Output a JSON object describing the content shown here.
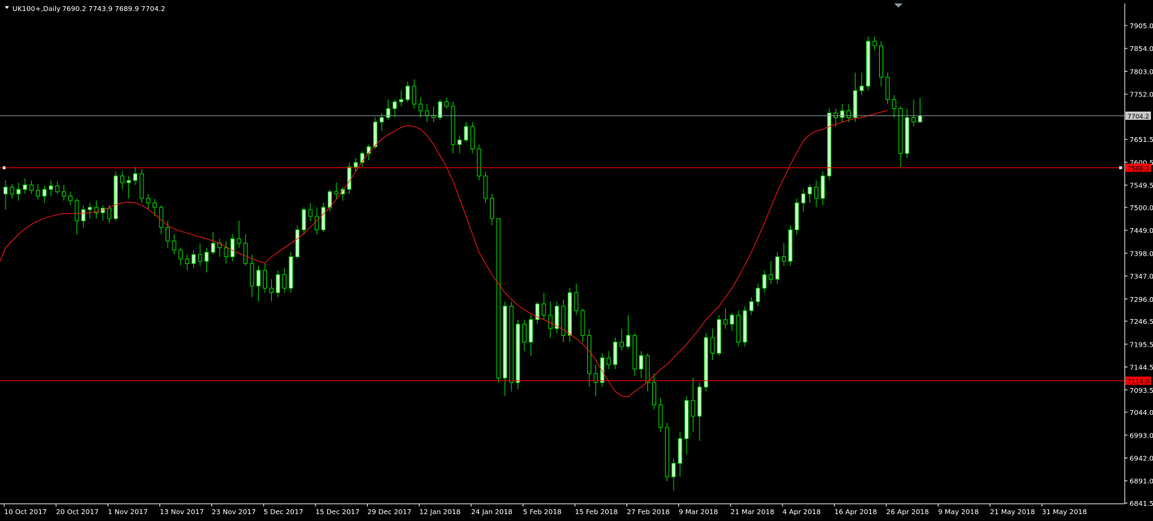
{
  "header": {
    "symbol": "UK100+,Daily",
    "ohlc": "7690.2 7743.9 7689.9 7704.2"
  },
  "colors": {
    "background": "#000000",
    "bull_body": "#ccffcc",
    "bear_body": "#000000",
    "wick": "#00dd00",
    "ma": "#ff1a1a",
    "hline": "#ff0000",
    "bid": "#8c9aa5",
    "axis": "#ffffff"
  },
  "price_axis": {
    "labels": [
      "7905.0",
      "7854.0",
      "7803.0",
      "7752.0",
      "7651.5",
      "7600.5",
      "7549.5",
      "7500.0",
      "7449.0",
      "7398.0",
      "7347.0",
      "7296.0",
      "7246.5",
      "7195.5",
      "7144.5",
      "7093.5",
      "7044.0",
      "6993.0",
      "6942.0",
      "6891.0",
      "6841.5"
    ],
    "current_price_tag": "7704.2",
    "resistance_tag": "7588.3",
    "support_tag": "7114.0"
  },
  "time_axis": {
    "labels": [
      "10 Oct 2017",
      "20 Oct 2017",
      "1 Nov 2017",
      "13 Nov 2017",
      "23 Nov 2017",
      "5 Dec 2017",
      "15 Dec 2017",
      "29 Dec 2017",
      "12 Jan 2018",
      "24 Jan 2018",
      "5 Feb 2018",
      "15 Feb 2018",
      "27 Feb 2018",
      "9 Mar 2018",
      "21 Mar 2018",
      "4 Apr 2018",
      "16 Apr 2018",
      "26 Apr 2018",
      "9 May 2018",
      "21 May 2018",
      "31 May 2018"
    ]
  },
  "chart_data": {
    "type": "candlestick",
    "timeframe": "Daily",
    "symbol": "UK100+",
    "ylim": [
      6841.5,
      7905.0
    ],
    "horizontal_lines": [
      7588.3,
      7114.0
    ],
    "current_price": 7704.2,
    "candles": [
      [
        7530,
        7560,
        7495,
        7545
      ],
      [
        7545,
        7552,
        7520,
        7530
      ],
      [
        7530,
        7555,
        7515,
        7540
      ],
      [
        7540,
        7565,
        7530,
        7550
      ],
      [
        7550,
        7560,
        7530,
        7538
      ],
      [
        7538,
        7552,
        7518,
        7525
      ],
      [
        7525,
        7548,
        7510,
        7540
      ],
      [
        7540,
        7560,
        7525,
        7548
      ],
      [
        7548,
        7558,
        7530,
        7535
      ],
      [
        7535,
        7550,
        7515,
        7525
      ],
      [
        7525,
        7535,
        7505,
        7515
      ],
      [
        7515,
        7520,
        7440,
        7470
      ],
      [
        7470,
        7505,
        7455,
        7495
      ],
      [
        7495,
        7510,
        7475,
        7500
      ],
      [
        7500,
        7515,
        7475,
        7488
      ],
      [
        7488,
        7505,
        7470,
        7498
      ],
      [
        7498,
        7505,
        7465,
        7475
      ],
      [
        7475,
        7580,
        7470,
        7570
      ],
      [
        7570,
        7580,
        7540,
        7555
      ],
      [
        7555,
        7570,
        7520,
        7560
      ],
      [
        7560,
        7590,
        7550,
        7575
      ],
      [
        7575,
        7585,
        7510,
        7520
      ],
      [
        7520,
        7530,
        7495,
        7510
      ],
      [
        7510,
        7520,
        7480,
        7500
      ],
      [
        7500,
        7505,
        7440,
        7455
      ],
      [
        7455,
        7470,
        7410,
        7425
      ],
      [
        7425,
        7440,
        7395,
        7405
      ],
      [
        7405,
        7410,
        7370,
        7385
      ],
      [
        7385,
        7395,
        7360,
        7375
      ],
      [
        7375,
        7405,
        7365,
        7395
      ],
      [
        7395,
        7420,
        7370,
        7380
      ],
      [
        7380,
        7410,
        7355,
        7400
      ],
      [
        7400,
        7445,
        7395,
        7420
      ],
      [
        7420,
        7430,
        7390,
        7410
      ],
      [
        7410,
        7425,
        7375,
        7390
      ],
      [
        7390,
        7440,
        7380,
        7430
      ],
      [
        7430,
        7470,
        7410,
        7420
      ],
      [
        7420,
        7440,
        7370,
        7375
      ],
      [
        7375,
        7395,
        7300,
        7325
      ],
      [
        7325,
        7370,
        7290,
        7360
      ],
      [
        7360,
        7375,
        7310,
        7320
      ],
      [
        7320,
        7340,
        7290,
        7310
      ],
      [
        7310,
        7360,
        7300,
        7350
      ],
      [
        7350,
        7365,
        7310,
        7320
      ],
      [
        7320,
        7400,
        7310,
        7390
      ],
      [
        7390,
        7460,
        7385,
        7450
      ],
      [
        7450,
        7500,
        7440,
        7495
      ],
      [
        7495,
        7510,
        7470,
        7480
      ],
      [
        7480,
        7500,
        7440,
        7450
      ],
      [
        7450,
        7510,
        7445,
        7500
      ],
      [
        7500,
        7540,
        7490,
        7535
      ],
      [
        7535,
        7555,
        7520,
        7530
      ],
      [
        7530,
        7545,
        7515,
        7540
      ],
      [
        7540,
        7600,
        7530,
        7590
      ],
      [
        7590,
        7610,
        7580,
        7600
      ],
      [
        7600,
        7625,
        7590,
        7620
      ],
      [
        7620,
        7640,
        7605,
        7635
      ],
      [
        7635,
        7700,
        7630,
        7690
      ],
      [
        7690,
        7710,
        7670,
        7700
      ],
      [
        7700,
        7740,
        7695,
        7720
      ],
      [
        7720,
        7740,
        7700,
        7735
      ],
      [
        7735,
        7760,
        7725,
        7740
      ],
      [
        7740,
        7780,
        7735,
        7770
      ],
      [
        7770,
        7785,
        7720,
        7730
      ],
      [
        7730,
        7745,
        7700,
        7715
      ],
      [
        7715,
        7730,
        7690,
        7705
      ],
      [
        7705,
        7725,
        7690,
        7700
      ],
      [
        7700,
        7740,
        7695,
        7735
      ],
      [
        7735,
        7745,
        7720,
        7725
      ],
      [
        7725,
        7735,
        7620,
        7640
      ],
      [
        7640,
        7660,
        7620,
        7650
      ],
      [
        7650,
        7690,
        7645,
        7680
      ],
      [
        7680,
        7690,
        7620,
        7630
      ],
      [
        7630,
        7640,
        7560,
        7570
      ],
      [
        7570,
        7580,
        7510,
        7520
      ],
      [
        7520,
        7530,
        7460,
        7475
      ],
      [
        7475,
        7390,
        7110,
        7120
      ],
      [
        7120,
        7290,
        7080,
        7280
      ],
      [
        7280,
        7290,
        7090,
        7110
      ],
      [
        7110,
        7250,
        7095,
        7240
      ],
      [
        7240,
        7250,
        7180,
        7200
      ],
      [
        7200,
        7260,
        7170,
        7250
      ],
      [
        7250,
        7290,
        7240,
        7285
      ],
      [
        7285,
        7310,
        7250,
        7260
      ],
      [
        7260,
        7290,
        7210,
        7230
      ],
      [
        7230,
        7290,
        7220,
        7280
      ],
      [
        7280,
        7295,
        7200,
        7215
      ],
      [
        7215,
        7320,
        7200,
        7310
      ],
      [
        7310,
        7330,
        7260,
        7270
      ],
      [
        7270,
        7275,
        7200,
        7215
      ],
      [
        7215,
        7230,
        7100,
        7130
      ],
      [
        7130,
        7150,
        7080,
        7110
      ],
      [
        7110,
        7175,
        7100,
        7165
      ],
      [
        7165,
        7180,
        7140,
        7150
      ],
      [
        7150,
        7210,
        7140,
        7200
      ],
      [
        7200,
        7230,
        7180,
        7190
      ],
      [
        7190,
        7260,
        7185,
        7215
      ],
      [
        7215,
        7220,
        7125,
        7140
      ],
      [
        7140,
        7180,
        7120,
        7170
      ],
      [
        7170,
        7175,
        7090,
        7110
      ],
      [
        7110,
        7130,
        7050,
        7060
      ],
      [
        7060,
        7075,
        7000,
        7010
      ],
      [
        7010,
        7020,
        6890,
        6900
      ],
      [
        6900,
        6940,
        6870,
        6930
      ],
      [
        6930,
        7000,
        6900,
        6985
      ],
      [
        6985,
        7080,
        6950,
        7070
      ],
      [
        7070,
        7120,
        7000,
        7035
      ],
      [
        7035,
        7110,
        6980,
        7100
      ],
      [
        7100,
        7220,
        7090,
        7210
      ],
      [
        7210,
        7230,
        7160,
        7175
      ],
      [
        7175,
        7260,
        7170,
        7250
      ],
      [
        7250,
        7275,
        7230,
        7240
      ],
      [
        7240,
        7265,
        7225,
        7260
      ],
      [
        7260,
        7270,
        7190,
        7200
      ],
      [
        7200,
        7280,
        7190,
        7270
      ],
      [
        7270,
        7300,
        7260,
        7290
      ],
      [
        7290,
        7330,
        7280,
        7320
      ],
      [
        7320,
        7360,
        7310,
        7350
      ],
      [
        7350,
        7380,
        7330,
        7340
      ],
      [
        7340,
        7400,
        7330,
        7390
      ],
      [
        7390,
        7420,
        7370,
        7380
      ],
      [
        7380,
        7460,
        7370,
        7450
      ],
      [
        7450,
        7520,
        7440,
        7510
      ],
      [
        7510,
        7540,
        7490,
        7530
      ],
      [
        7530,
        7550,
        7510,
        7545
      ],
      [
        7545,
        7560,
        7500,
        7520
      ],
      [
        7520,
        7580,
        7505,
        7570
      ],
      [
        7570,
        7720,
        7560,
        7710
      ],
      [
        7710,
        7720,
        7680,
        7700
      ],
      [
        7700,
        7730,
        7690,
        7715
      ],
      [
        7715,
        7730,
        7690,
        7700
      ],
      [
        7700,
        7800,
        7690,
        7760
      ],
      [
        7760,
        7800,
        7750,
        7770
      ],
      [
        7770,
        7880,
        7760,
        7870
      ],
      [
        7870,
        7880,
        7850,
        7860
      ],
      [
        7860,
        7870,
        7770,
        7790
      ],
      [
        7790,
        7800,
        7730,
        7740
      ],
      [
        7740,
        7750,
        7700,
        7720
      ],
      [
        7720,
        7725,
        7590,
        7620
      ],
      [
        7620,
        7720,
        7610,
        7700
      ],
      [
        7700,
        7740,
        7680,
        7690
      ],
      [
        7690,
        7744,
        7690,
        7704
      ]
    ],
    "moving_average": {
      "type": "line",
      "values": [
        7410,
        7425,
        7440,
        7452,
        7462,
        7470,
        7476,
        7480,
        7484,
        7486,
        7486,
        7486,
        7487,
        7488,
        7490,
        7494,
        7500,
        7506,
        7510,
        7512,
        7510,
        7505,
        7496,
        7485,
        7472,
        7460,
        7452,
        7447,
        7443,
        7438,
        7434,
        7430,
        7425,
        7420,
        7412,
        7404,
        7398,
        7392,
        7386,
        7380,
        7376,
        7390,
        7400,
        7410,
        7420,
        7430,
        7442,
        7456,
        7470,
        7485,
        7500,
        7518,
        7538,
        7558,
        7580,
        7602,
        7622,
        7638,
        7652,
        7662,
        7670,
        7678,
        7682,
        7680,
        7674,
        7660,
        7640,
        7615,
        7590,
        7558,
        7520,
        7480,
        7440,
        7400,
        7375,
        7350,
        7330,
        7310,
        7295,
        7282,
        7272,
        7263,
        7256,
        7250,
        7243,
        7236,
        7228,
        7218,
        7208,
        7195,
        7180,
        7160,
        7135,
        7112,
        7090,
        7080,
        7078,
        7090,
        7100,
        7112,
        7125,
        7140,
        7150,
        7165,
        7180,
        7195,
        7212,
        7230,
        7250,
        7265,
        7280,
        7300,
        7320,
        7345,
        7372,
        7400,
        7432,
        7465,
        7500,
        7535,
        7565,
        7595,
        7622,
        7648,
        7662,
        7670,
        7674,
        7680,
        7685,
        7690,
        7694,
        7698,
        7700,
        7704,
        7708,
        7712,
        7716
      ]
    }
  }
}
